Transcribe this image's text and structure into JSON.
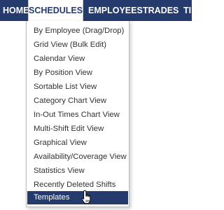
{
  "navbar": {
    "items": [
      {
        "label": "HOME"
      },
      {
        "label": "SCHEDULES",
        "active": true
      },
      {
        "label": "EMPLOYEES"
      },
      {
        "label": "TRADES"
      },
      {
        "label": "TI"
      }
    ]
  },
  "schedules_menu": {
    "items": [
      {
        "label": "By Employee (Drag/Drop)"
      },
      {
        "label": "Grid View (Bulk Edit)"
      },
      {
        "label": "Calendar View"
      },
      {
        "label": "By Position View"
      },
      {
        "label": "Sortable List View"
      },
      {
        "label": "Category Chart View"
      },
      {
        "label": "In-Out Times Chart View"
      },
      {
        "label": "Multi-Shift Edit View"
      },
      {
        "label": "Graphical View"
      },
      {
        "label": "Availability/Coverage View"
      },
      {
        "label": "Statistics View"
      },
      {
        "label": "Recently Deleted Shifts"
      },
      {
        "label": "Templates",
        "highlighted": true
      }
    ]
  },
  "colors": {
    "navbar_background": "#253b6e",
    "highlight_background": "#253b6e"
  },
  "icons": {
    "cursor": "hand-pointer-icon"
  }
}
